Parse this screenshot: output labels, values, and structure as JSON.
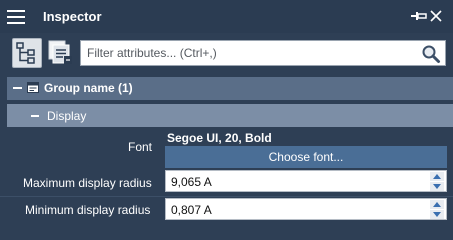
{
  "window": {
    "title": "Inspector",
    "icons": {
      "menu": "hamburger-icon",
      "pin": "pin-icon",
      "close": "close-icon"
    }
  },
  "toolbar": {
    "tree_button_icon": "tree-view-icon",
    "attributes_button_icon": "attribute-panel-icon",
    "filter_placeholder": "Filter attributes... (Ctrl+,)",
    "filter_value": "",
    "search_icon": "search-icon"
  },
  "group": {
    "label": "Group name (1)",
    "expanded": true,
    "icon": "group-icon"
  },
  "section": {
    "label": "Display",
    "expanded": true
  },
  "properties": {
    "font": {
      "label": "Font",
      "value": "Segoe UI, 20, Bold",
      "button_label": "Choose font..."
    },
    "max_radius": {
      "label": "Maximum display radius",
      "value": "9,065 A"
    },
    "min_radius": {
      "label": "Minimum display radius",
      "value": "0,807 A"
    }
  },
  "colors": {
    "panel_bg": "#2e3f55",
    "group_header": "#5a6e88",
    "section_header": "#7c8ea6",
    "button": "#4a6e96",
    "spinner_arrow": "#3a6fb0"
  }
}
